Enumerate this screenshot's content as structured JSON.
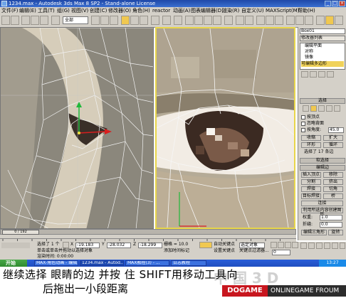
{
  "window": {
    "title": "1234.max - Autodesk 3ds Max 8 SP2 - Stand-alone License",
    "buttons": [
      "_",
      "□",
      "×"
    ]
  },
  "menu": [
    "文件(F)",
    "编辑(E)",
    "工具(T)",
    "组(G)",
    "视图(V)",
    "创建(C)",
    "修改器(O)",
    "角色(H)",
    "reactor",
    "动画(A)",
    "图表编辑器(D)",
    "渲染(R)",
    "自定义(U)",
    "MAXScript(M)",
    "帮助(H)"
  ],
  "toolbar": {
    "selection_filter": "全部"
  },
  "viewports": {
    "left_counter": "0 / 192"
  },
  "command_panel": {
    "object_name": "Box01",
    "modifier_list": "修改器列表",
    "stack": [
      "编辑平面",
      "对称",
      "镜像",
      "可编辑多边形"
    ],
    "selection_rollout": "选择",
    "by_vertex": "按顶点",
    "ignore_backface": "忽略背面",
    "by_angle": "按角度:",
    "angle_value": "45.0",
    "shrink": "收缩",
    "grow": "扩大",
    "ring": "环形",
    "loop": "循环",
    "selected_count": "选择了 17 条边",
    "soft_selection": "软选择",
    "edit_edges": "编辑边",
    "insert_vertex": "插入顶点",
    "remove": "移除",
    "split": "分割",
    "extrude": "挤出",
    "weld": "焊接",
    "chamfer": "切角",
    "target_weld": "目标焊接",
    "bridge": "桥",
    "connect": "连接",
    "create_shape": "利用所选内容创建图形",
    "weight_label": "权重:",
    "weight_value": "1.0",
    "crease_label": "折缝:",
    "crease_value": "0.0",
    "edit_tri": "编辑三角形",
    "rotate": "旋转"
  },
  "timeline": {
    "frame": "0 / 192",
    "tick_labels": [
      "0",
      "10",
      "20",
      "30",
      "40",
      "50",
      "60",
      "70",
      "80",
      "90",
      "100",
      "110",
      "120",
      "130",
      "140",
      "150",
      "160",
      "170",
      "180",
      "190"
    ]
  },
  "status": {
    "selected": "选择了 1 个",
    "x_label": "X",
    "x_value": "-19.183",
    "y_label": "Y",
    "y_value": "-28.032",
    "z_label": "Z",
    "z_value": "-18.299",
    "grid": "栅格 = 10.0",
    "auto_key": "自动关键点",
    "selected_obj": "选定对象",
    "set_key": "设置关键点",
    "key_filter": "关键点过滤器...",
    "hint": "单击或单击并拖动以选择对象",
    "add_time_tag": "添加时间标记",
    "frame_value": "0",
    "render_time": "渲染时间: 0:00:00"
  },
  "taskbar": {
    "start": "开始",
    "tasks": [
      "MAX-角色动画 - 编辑...",
      "1234.max - Autod...",
      "MAX教程(3) - ...",
      "日志教程"
    ],
    "clock": "13:27"
  },
  "caption": {
    "line1": "继续选择 眼睛的边  并按 住 SHIFT用移动工具向",
    "line2": "后拖出一小段距离",
    "watermark": "中 国 3 D",
    "logo_left": "DOGAME",
    "logo_right": "ONLINEGAME FROUM"
  },
  "colors": {
    "title_bar": "#2a5cc0",
    "ui_gray": "#d4d0c8",
    "active_viewport_border": "#e8d64a",
    "taskbar": "#2a5ed8",
    "logo_red": "#c8161e"
  }
}
